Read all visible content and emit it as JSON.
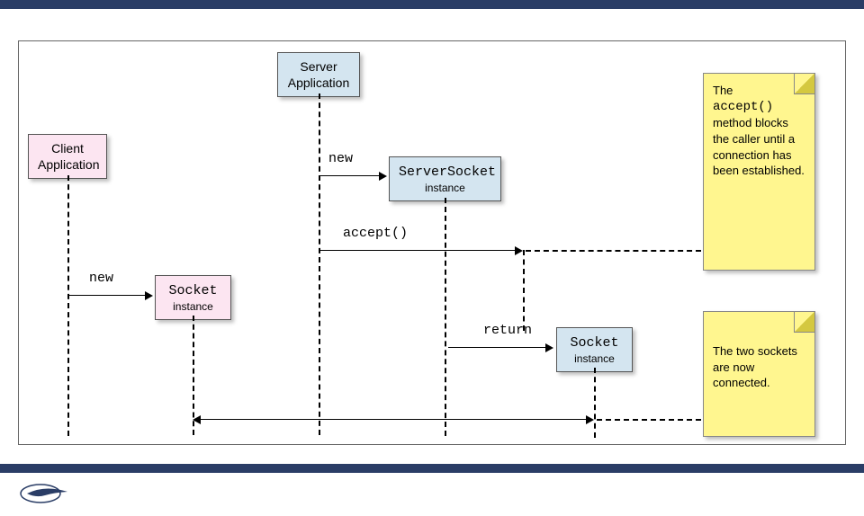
{
  "participants": {
    "client": {
      "label": "Client\nApplication"
    },
    "server": {
      "label": "Server\nApplication"
    },
    "serversocket": {
      "title": "ServerSocket",
      "subtitle": "instance"
    },
    "clientsocket": {
      "title": "Socket",
      "subtitle": "instance"
    },
    "acceptsocket": {
      "title": "Socket",
      "subtitle": "instance"
    }
  },
  "messages": {
    "msg1": {
      "label": "new"
    },
    "msg2": {
      "label": "accept()"
    },
    "msg3": {
      "label": "new"
    },
    "msg4": {
      "label": "return"
    }
  },
  "notes": {
    "n1": {
      "line1": "The",
      "code": "accept()",
      "rest": "method blocks the caller until a connection has been established."
    },
    "n2": {
      "text": "The two sockets are now connected."
    }
  }
}
